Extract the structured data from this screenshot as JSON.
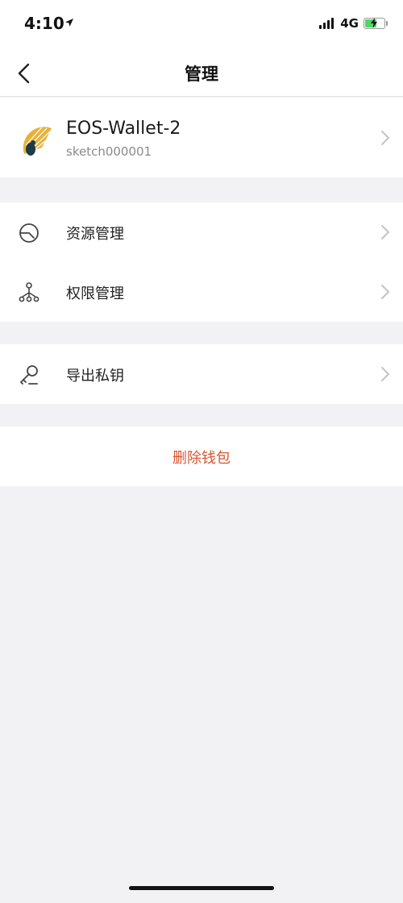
{
  "status_bar": {
    "time": "4:10",
    "network": "4G"
  },
  "nav": {
    "title": "管理"
  },
  "wallet": {
    "name": "EOS-Wallet-2",
    "account": "sketch000001"
  },
  "menu": {
    "resource_label": "资源管理",
    "permission_label": "权限管理",
    "export_key_label": "导出私钥"
  },
  "actions": {
    "delete_wallet_label": "删除钱包"
  },
  "colors": {
    "danger": "#d9542f",
    "background": "#f2f2f4"
  }
}
